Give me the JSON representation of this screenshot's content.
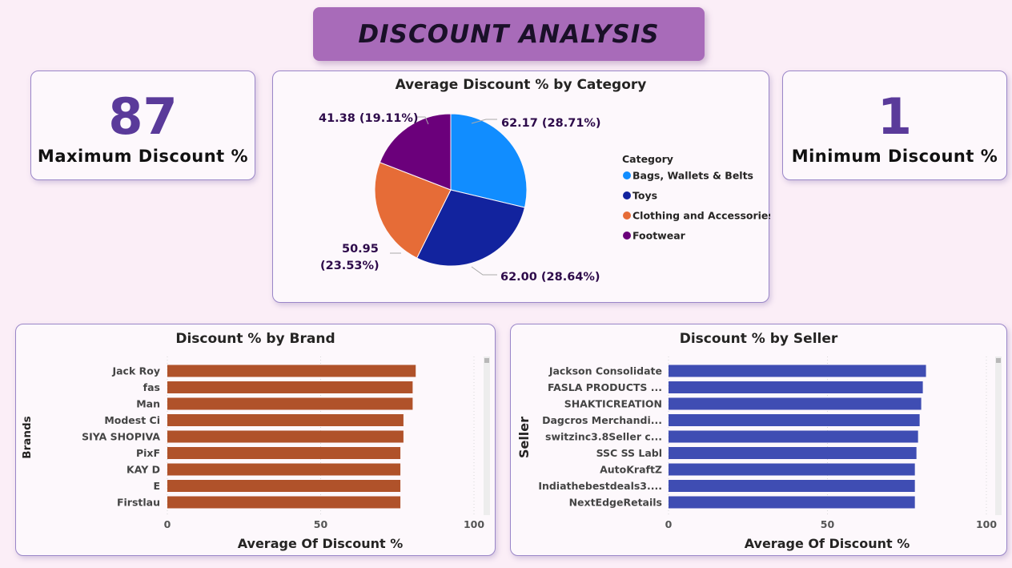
{
  "page": {
    "title": "DISCOUNT ANALYSIS",
    "title_bg": "#a86bb9",
    "background": "#fbeef7"
  },
  "kpis": {
    "max": {
      "value": "87",
      "label": "Maximum Discount %"
    },
    "min": {
      "value": "1",
      "label": "Minimum Discount %"
    }
  },
  "chart_data": [
    {
      "type": "pie",
      "title": "Average Discount % by Category",
      "legend_title": "Category",
      "legend_position": "right",
      "slices": [
        {
          "name": "Bags, Wallets & Belts",
          "value": 62.17,
          "percent": "28.71%",
          "label": "62.17 (28.71%)",
          "color": "#118dff"
        },
        {
          "name": "Toys",
          "value": 62.0,
          "percent": "28.64%",
          "label": "62.00 (28.64%)",
          "color": "#12239e"
        },
        {
          "name": "Clothing and Accessories",
          "value": 50.95,
          "percent": "23.53%",
          "label_line1": "50.95",
          "label_line2": "(23.53%)",
          "color": "#e66c37"
        },
        {
          "name": "Footwear",
          "value": 41.38,
          "percent": "19.11%",
          "label": "41.38 (19.11%)",
          "color": "#6b007b"
        }
      ]
    },
    {
      "type": "bar",
      "orientation": "horizontal",
      "title": "Discount % by Brand",
      "xlabel": "Average Of Discount %",
      "ylabel": "Brands",
      "xlim": [
        0,
        100
      ],
      "xticks": [
        0,
        50,
        100
      ],
      "color": "#b0522a",
      "categories": [
        "Jack Roy",
        "fas",
        "Man",
        "Modest Ci",
        "SIYA SHOPIVA",
        "PixF",
        "KAY D",
        "E",
        "Firstlau"
      ],
      "values": [
        81,
        80,
        80,
        77,
        77,
        76,
        76,
        76,
        76
      ]
    },
    {
      "type": "bar",
      "orientation": "horizontal",
      "title": "Discount % by Seller",
      "xlabel": "Average Of Discount %",
      "ylabel": "Seller",
      "xlim": [
        0,
        100
      ],
      "xticks": [
        0,
        50,
        100
      ],
      "color": "#3f4db3",
      "categories": [
        "Jackson Consolidate",
        "FASLA PRODUCTS ...",
        "SHAKTICREATION",
        "Dagcros Merchandi...",
        "switzinc3.8Seller c...",
        "SSC SS Labl",
        "AutoKraftZ",
        "Indiathebestdeals3....",
        "NextEdgeRetails"
      ],
      "values": [
        81,
        80,
        79.5,
        79,
        78.5,
        78,
        77.5,
        77.5,
        77.5
      ]
    }
  ]
}
